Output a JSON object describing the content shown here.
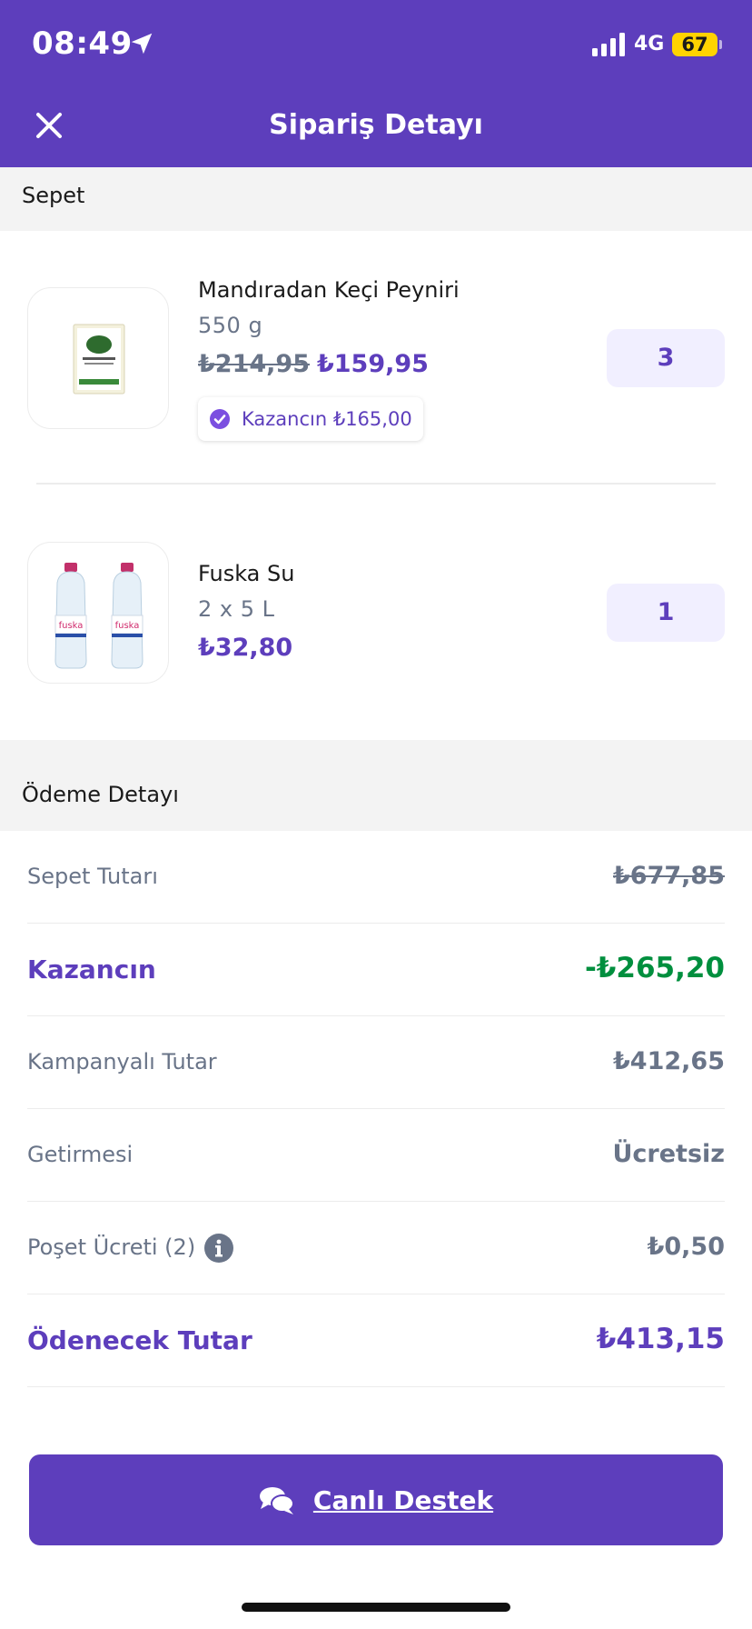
{
  "status_bar": {
    "time": "08:49",
    "network": "4G",
    "battery": "67"
  },
  "header": {
    "title": "Sipariş Detayı",
    "close_icon": "close-icon"
  },
  "cart": {
    "section_title": "Sepet",
    "items": [
      {
        "name": "Mandıradan Keçi Peyniri",
        "size": "550 g",
        "old_price": "₺214,95",
        "price": "₺159,95",
        "savings_badge": "Kazancın ₺165,00",
        "quantity": "3"
      },
      {
        "name": "Fuska Su",
        "size": "2 x 5 L",
        "price": "₺32,80",
        "quantity": "1"
      }
    ]
  },
  "payment": {
    "section_title": "Ödeme Detayı",
    "rows": [
      {
        "label": "Sepet Tutarı",
        "value": "₺677,85"
      },
      {
        "label": "Kazancın",
        "value": "-₺265,20"
      },
      {
        "label": "Kampanyalı Tutar",
        "value": "₺412,65"
      },
      {
        "label": "Getirmesi",
        "value": "Ücretsiz"
      },
      {
        "label": "Poşet Ücreti (2)",
        "value": "₺0,50"
      },
      {
        "label": "Ödenecek Tutar",
        "value": "₺413,15"
      }
    ]
  },
  "support_button": {
    "label": "Canlı Destek"
  },
  "colors": {
    "brand": "#5d3ebc",
    "savings": "#008f3e",
    "muted": "#697488"
  }
}
